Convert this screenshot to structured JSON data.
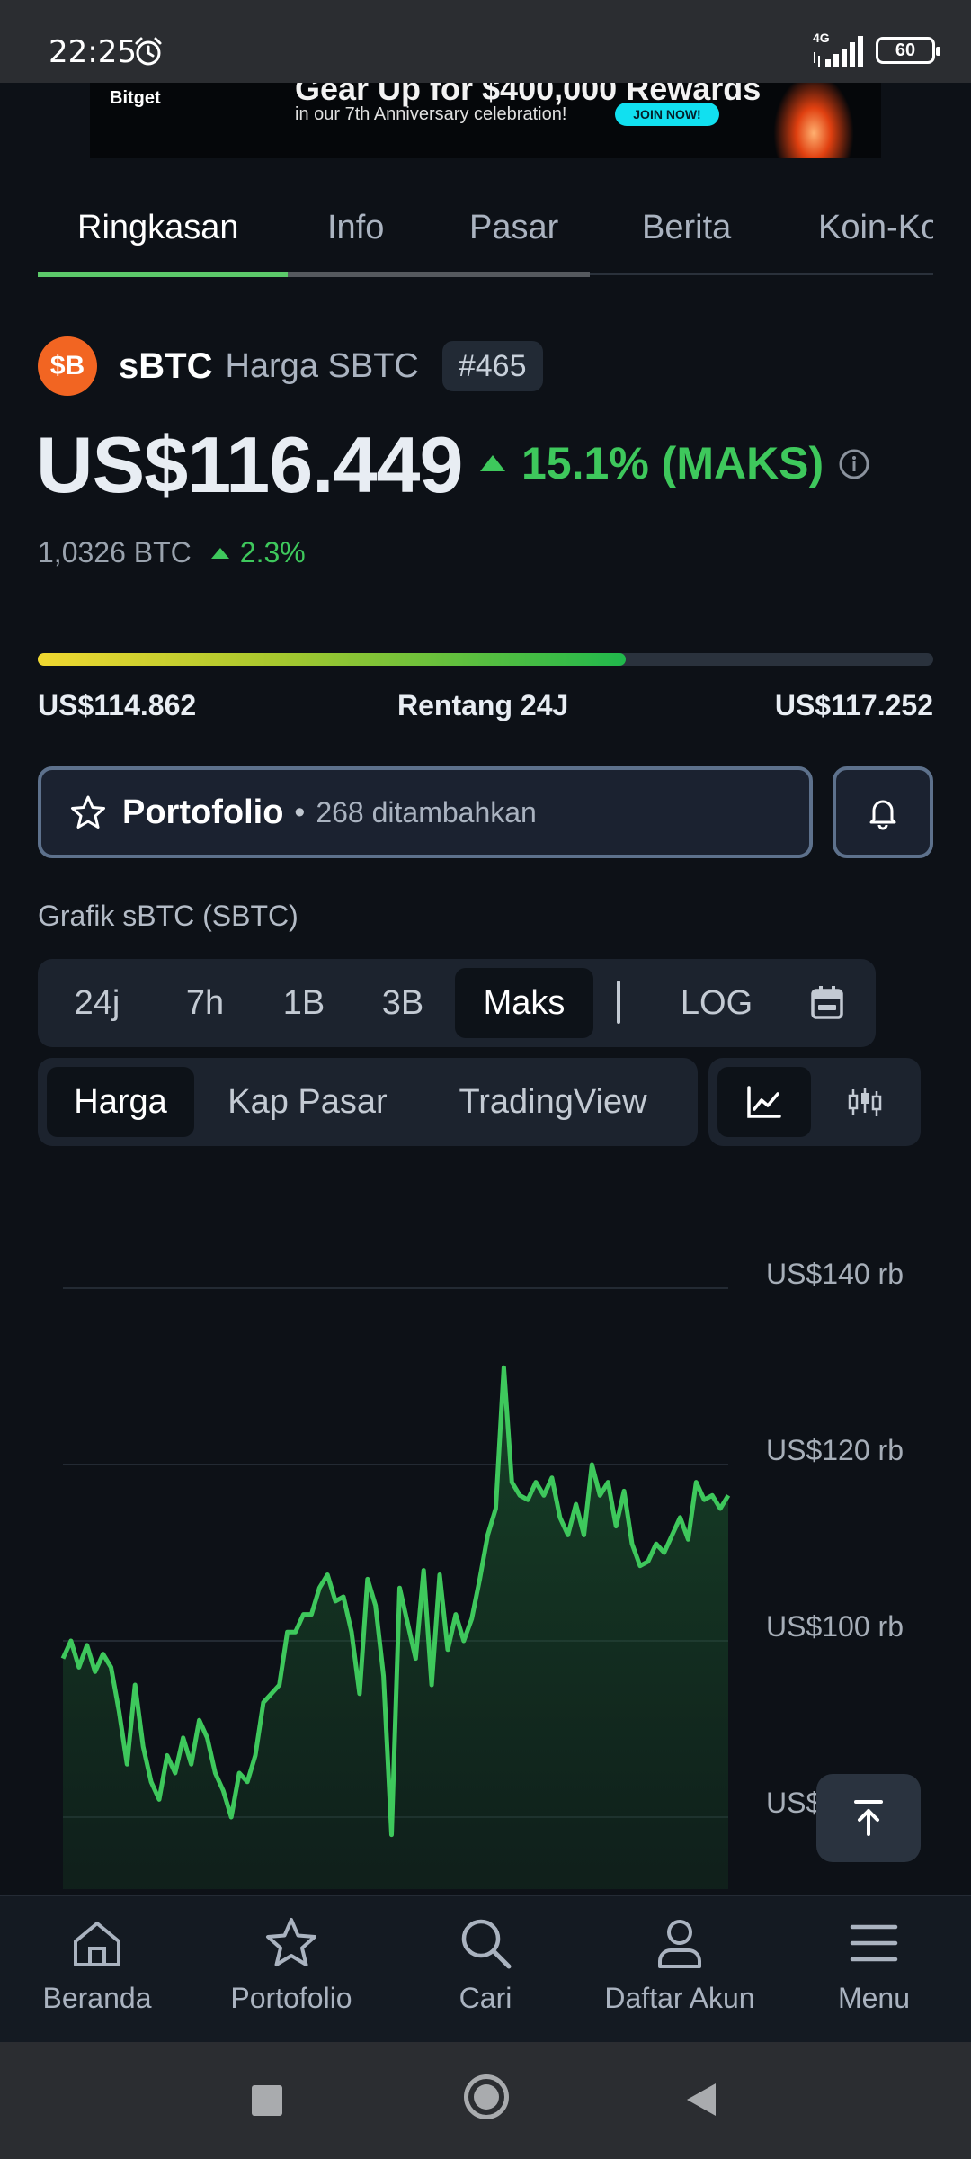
{
  "status_bar": {
    "time": "22:25",
    "network": "4G",
    "battery": "60"
  },
  "ad": {
    "logo": "Bitget",
    "headline": "Gear Up for $400,000 Rewards",
    "subline": "in our 7th Anniversary celebration!",
    "cta": "JOIN NOW!"
  },
  "tabs": [
    "Ringkasan",
    "Info",
    "Pasar",
    "Berita",
    "Koin-Ko"
  ],
  "coin": {
    "logo_text": "$B",
    "symbol": "sBTC",
    "subtitle": "Harga SBTC",
    "rank": "#465",
    "price": "US$116.449",
    "change": "15.1% (MAKS)",
    "btc_value": "1,0326 BTC",
    "btc_change": "2.3%"
  },
  "range": {
    "low": "US$114.862",
    "label": "Rentang 24J",
    "high": "US$117.252",
    "fill_fraction": 0.657
  },
  "portfolio": {
    "label": "Portofolio",
    "dot": "•",
    "count": "268 ditambahkan"
  },
  "chart_section": {
    "title": "Grafik sBTC (SBTC)",
    "ranges": [
      "24j",
      "7h",
      "1B",
      "3B",
      "Maks"
    ],
    "active_range": "Maks",
    "log": "LOG",
    "views": [
      "Harga",
      "Kap Pasar",
      "TradingView"
    ],
    "active_view": "Harga"
  },
  "chart_data": {
    "type": "area",
    "title": "",
    "xlabel": "",
    "ylabel": "",
    "ylim": [
      80000,
      140000
    ],
    "yticks": [
      "US$140 rb",
      "US$120 rb",
      "US$100 rb",
      "US$80 rb"
    ],
    "grid": true,
    "color": "#3ec85c",
    "series": [
      {
        "values": [
          98000,
          100000,
          97000,
          99500,
          96500,
          98500,
          97000,
          92000,
          86000,
          95000,
          88000,
          84000,
          82000,
          87000,
          85000,
          89000,
          86000,
          91000,
          89000,
          85000,
          83000,
          80000,
          85000,
          84000,
          87000,
          93000,
          94000,
          95000,
          101000,
          101000,
          103000,
          103000,
          106000,
          107500,
          104500,
          105000,
          101000,
          94000,
          107000,
          104000,
          96000,
          78000,
          106000,
          102000,
          98000,
          108000,
          95000,
          107500,
          99000,
          103000,
          100000,
          102500,
          107000,
          112000,
          115000,
          131000,
          118000,
          116500,
          116000,
          118000,
          116500,
          118500,
          114000,
          112000,
          115500,
          112000,
          120000,
          116500,
          118000,
          113000,
          117000,
          111000,
          108500,
          109000,
          111000,
          110000,
          112000,
          114000,
          111500,
          118000,
          116000,
          116500,
          115000,
          116500
        ]
      }
    ]
  },
  "bottom_nav": [
    "Beranda",
    "Portofolio",
    "Cari",
    "Daftar Akun",
    "Menu"
  ]
}
